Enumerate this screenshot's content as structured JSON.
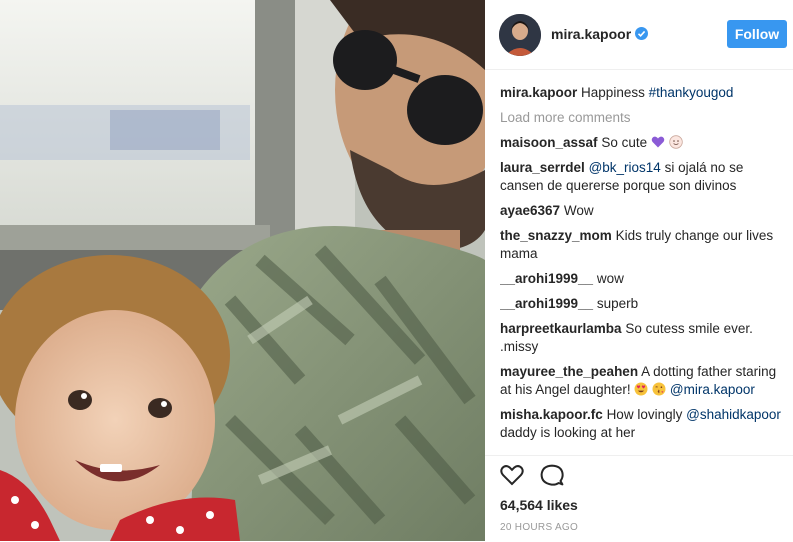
{
  "header": {
    "username": "mira.kapoor",
    "follow_label": "Follow"
  },
  "caption": {
    "username": "mira.kapoor",
    "text": "Happiness",
    "hashtag": "#thankyougod"
  },
  "load_more": "Load more comments",
  "comments": [
    {
      "user": "maisoon_assaf",
      "pre": "",
      "mention": "",
      "text": "So cute",
      "emoji": "purple-heart,face"
    },
    {
      "user": "laura_serrdel",
      "pre": "",
      "mention": "@bk_rios14",
      "text": " si ojalá no se cansen de quererse porque son divinos",
      "emoji": ""
    },
    {
      "user": "ayae6367",
      "pre": "",
      "mention": "",
      "text": "Wow",
      "emoji": ""
    },
    {
      "user": "the_snazzy_mom",
      "pre": "",
      "mention": "",
      "text": "Kids truly change our lives mama",
      "emoji": ""
    },
    {
      "user": "__arohi1999__",
      "pre": "",
      "mention": "",
      "text": "wow",
      "emoji": ""
    },
    {
      "user": "__arohi1999__",
      "pre": "",
      "mention": "",
      "text": "superb",
      "emoji": ""
    },
    {
      "user": "harpreetkaurlamba",
      "pre": "",
      "mention": "",
      "text": "So cutess smile ever. .missy",
      "emoji": ""
    },
    {
      "user": "mayuree_the_peahen",
      "pre": "A dotting father staring at his Angel daughter!",
      "mention": "@mira.kapoor",
      "text": "",
      "emoji": "heart-eyes,kiss"
    },
    {
      "user": "misha.kapoor.fc",
      "pre": "How lovingly",
      "mention": "@shahidkapoor",
      "text": " daddy is looking at her",
      "emoji": ""
    }
  ],
  "likes": "64,564 likes",
  "timestamp": "20 HOURS AGO",
  "colors": {
    "follow_bg": "#3897f0",
    "link": "#003569",
    "muted": "#999999"
  }
}
